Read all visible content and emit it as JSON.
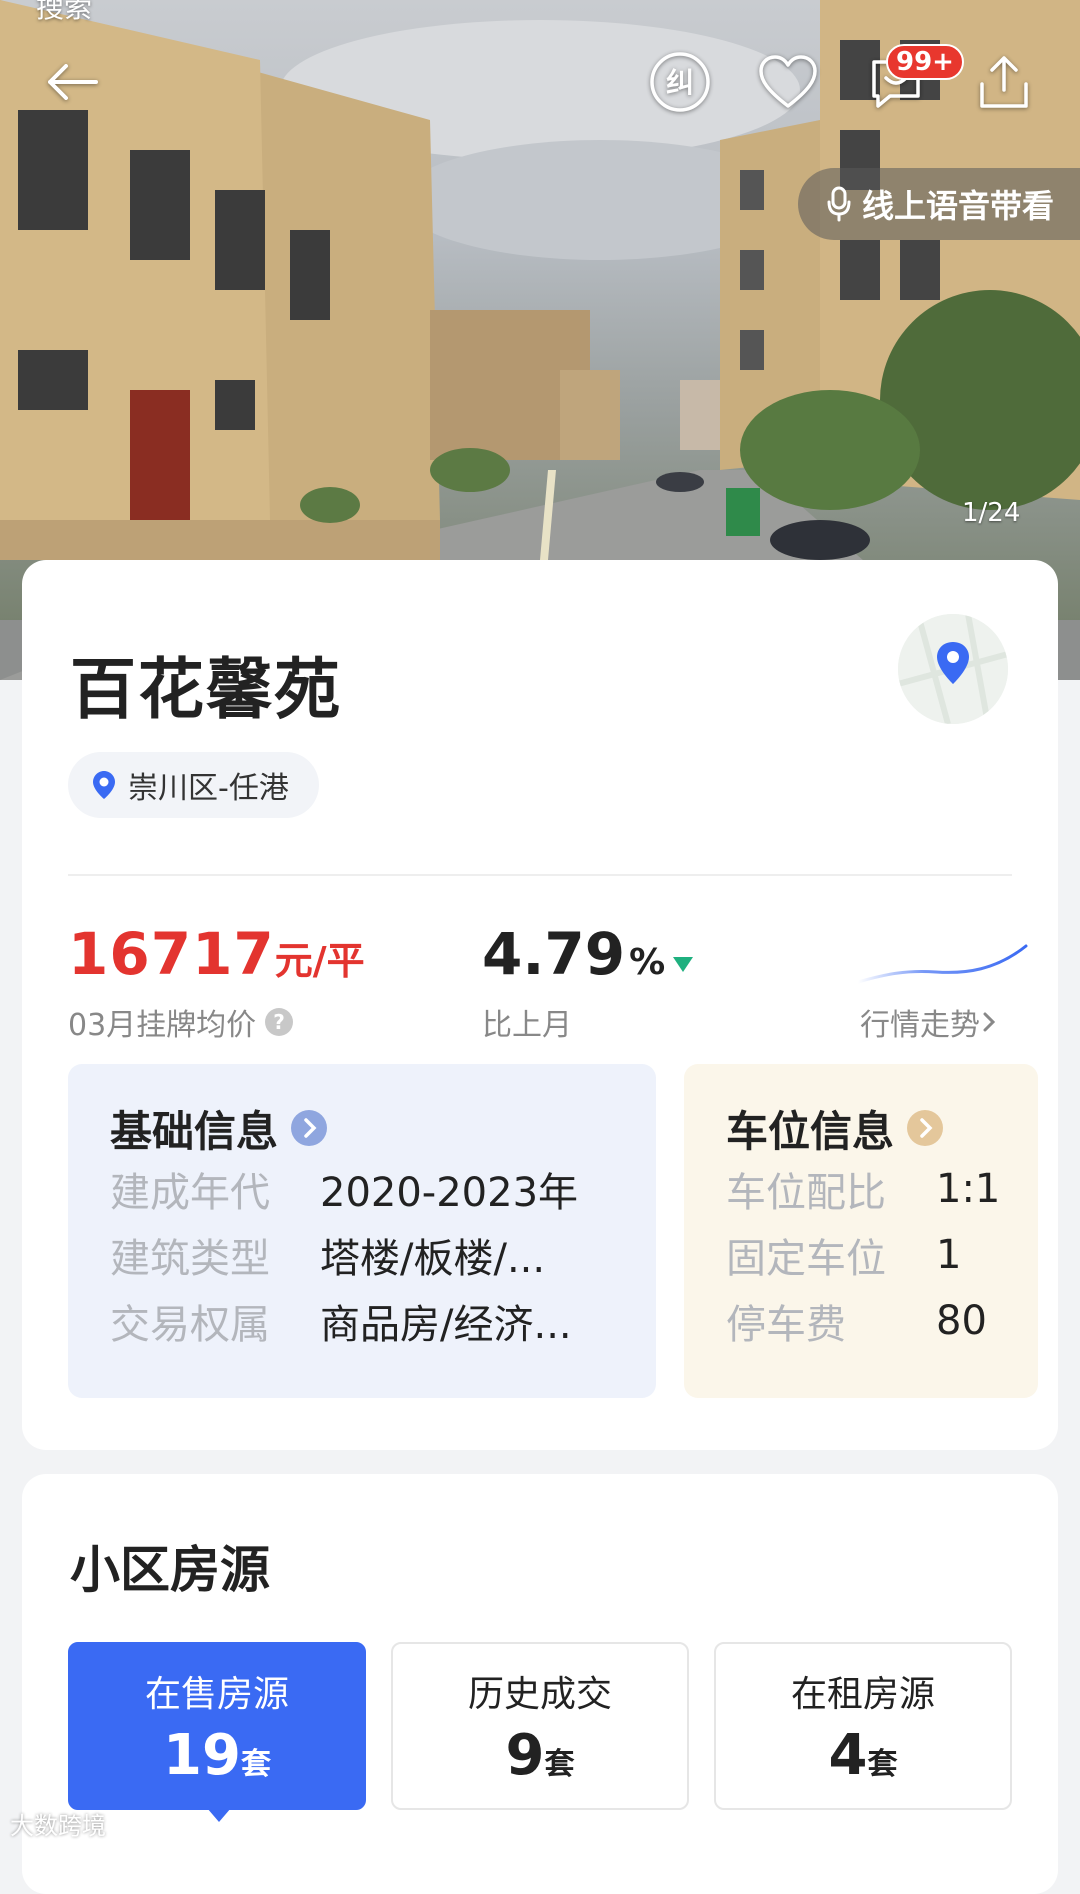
{
  "hero": {
    "top_label": "搜索",
    "badge_count": "99+",
    "voice_label": "线上语音带看",
    "photo_counter": "1/24"
  },
  "community": {
    "name": "百花馨苑",
    "location": "崇川区-任港"
  },
  "price": {
    "value": "16717",
    "unit": "元/平",
    "label": "03月挂牌均价",
    "change_value": "4.79",
    "change_unit": "%",
    "change_label": "比上月",
    "trend_link": "行情走势"
  },
  "basic_info": {
    "title": "基础信息",
    "rows": [
      {
        "key": "建成年代",
        "value": "2020-2023年"
      },
      {
        "key": "建筑类型",
        "value": "塔楼/板楼/..."
      },
      {
        "key": "交易权属",
        "value": "商品房/经济..."
      }
    ]
  },
  "parking_info": {
    "title": "车位信息",
    "rows": [
      {
        "key": "车位配比",
        "value": "1:1"
      },
      {
        "key": "固定车位",
        "value": "1"
      },
      {
        "key": "停车费",
        "value": "80"
      }
    ]
  },
  "listings": {
    "title": "小区房源",
    "tabs": [
      {
        "label": "在售房源",
        "count": "19",
        "unit": "套"
      },
      {
        "label": "历史成交",
        "count": "9",
        "unit": "套"
      },
      {
        "label": "在租房源",
        "count": "4",
        "unit": "套"
      }
    ]
  },
  "watermark": "大数跨境",
  "colors": {
    "accent_blue": "#3a6af3",
    "price_red": "#e3342f",
    "down_green": "#1fb07f"
  }
}
